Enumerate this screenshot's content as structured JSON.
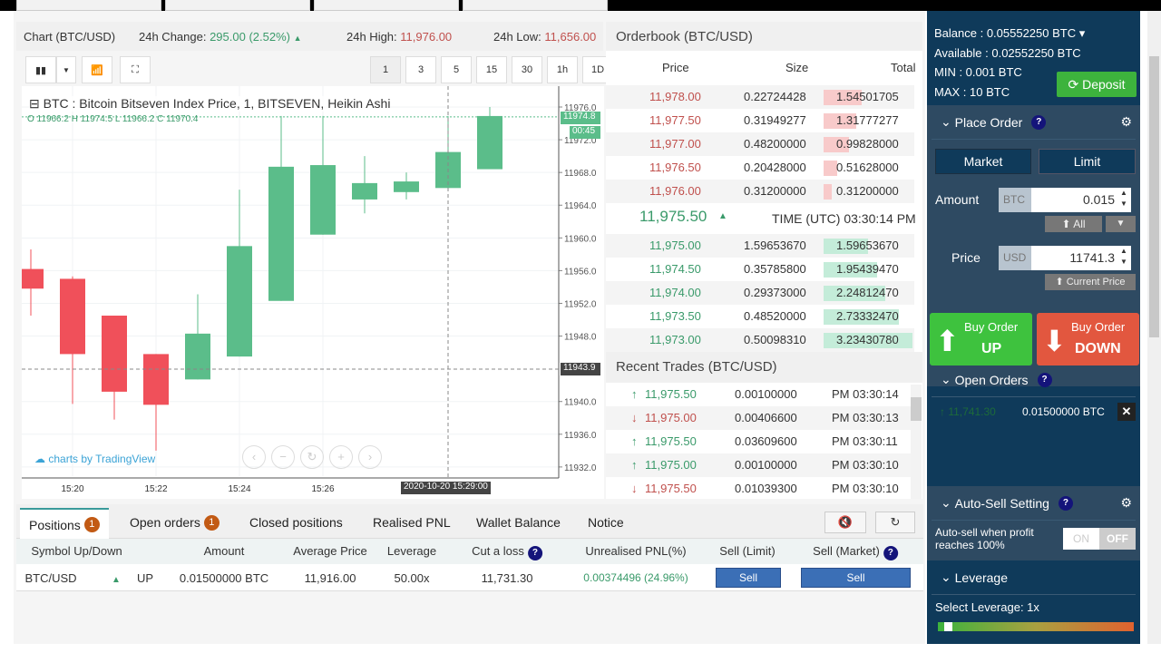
{
  "chart_header": {
    "title": "Chart (BTC/USD)",
    "change_label": "24h Change:",
    "change_value": "295.00 (2.52%)",
    "change_arrow": "▲",
    "high_label": "24h High:",
    "high_value": "11,976.00",
    "low_label": "24h Low:",
    "low_value": "11,656.00"
  },
  "toolbar": {
    "intervals": [
      "1",
      "3",
      "5",
      "15",
      "30",
      "1h",
      "1D"
    ],
    "active_interval": "1"
  },
  "chart": {
    "legend": "BTC : Bitcoin Bitseven Index Price, 1, BITSEVEN, Heikin Ashi",
    "ohlc": "O 11966.2  H 11974.5  L 11966.2  C 11970.4",
    "last_price_tag": "11974.8",
    "countdown": "00:45",
    "crosshair_price": "11943.9",
    "crosshair_time": "2020-10-20 15:29:00",
    "watermark": "charts by TradingView"
  },
  "chart_data": {
    "type": "candlestick",
    "x_ticks": [
      "15:20",
      "15:22",
      "15:24",
      "15:26"
    ],
    "y_ticks": [
      11976.0,
      11972.0,
      11968.0,
      11964.0,
      11960.0,
      11956.0,
      11952.0,
      11948.0,
      11940.0,
      11936.0,
      11932.0
    ],
    "ylim": [
      11930,
      11977
    ],
    "candles": [
      {
        "t": "15:19",
        "o": 11956.2,
        "h": 11958.6,
        "l": 11950.5,
        "c": 11953.8
      },
      {
        "t": "15:20",
        "o": 11955.0,
        "h": 11955.3,
        "l": 11939.7,
        "c": 11945.8
      },
      {
        "t": "15:21",
        "o": 11950.5,
        "h": 11950.5,
        "l": 11937.8,
        "c": 11941.2
      },
      {
        "t": "15:22",
        "o": 11945.8,
        "h": 11945.8,
        "l": 11934.0,
        "c": 11939.6
      },
      {
        "t": "15:23",
        "o": 11942.7,
        "h": 11953.1,
        "l": 11942.7,
        "c": 11948.3
      },
      {
        "t": "15:24",
        "o": 11945.5,
        "h": 11965.9,
        "l": 11945.5,
        "c": 11959.0
      },
      {
        "t": "15:25",
        "o": 11952.3,
        "h": 11974.9,
        "l": 11952.3,
        "c": 11968.7
      },
      {
        "t": "15:26",
        "o": 11960.4,
        "h": 11974.9,
        "l": 11960.4,
        "c": 11968.9
      },
      {
        "t": "15:27",
        "o": 11964.7,
        "h": 11970.0,
        "l": 11963.0,
        "c": 11966.7
      },
      {
        "t": "15:28",
        "o": 11965.6,
        "h": 11968.0,
        "l": 11964.7,
        "c": 11966.9
      },
      {
        "t": "15:29",
        "o": 11966.1,
        "h": 11974.9,
        "l": 11966.1,
        "c": 11970.5
      },
      {
        "t": "15:30",
        "o": 11968.4,
        "h": 11976.0,
        "l": 11968.4,
        "c": 11974.9
      }
    ],
    "colors": {
      "up": "#5bbd8a",
      "down": "#f0505a"
    }
  },
  "orderbook": {
    "title": "Orderbook (BTC/USD)",
    "headers": [
      "Price",
      "Size",
      "Total"
    ],
    "asks": [
      [
        "11,978.00",
        "0.22724428",
        "1.54501705",
        0.42
      ],
      [
        "11,977.50",
        "0.31949277",
        "1.31777277",
        0.36
      ],
      [
        "11,977.00",
        "0.48200000",
        "0.99828000",
        0.28
      ],
      [
        "11,976.50",
        "0.20428000",
        "0.51628000",
        0.15
      ],
      [
        "11,976.00",
        "0.31200000",
        "0.31200000",
        0.09
      ]
    ],
    "last_price": "11,975.50",
    "last_arrow": "▲",
    "time": "TIME (UTC) 03:30:14 PM",
    "bids": [
      [
        "11,975.00",
        "1.59653670",
        "1.59653670",
        0.49
      ],
      [
        "11,974.50",
        "0.35785800",
        "1.95439470",
        0.59
      ],
      [
        "11,974.00",
        "0.29373000",
        "2.24812470",
        0.68
      ],
      [
        "11,973.50",
        "0.48520000",
        "2.73332470",
        0.83
      ],
      [
        "11,973.00",
        "0.50098310",
        "3.23430780",
        0.98
      ]
    ]
  },
  "recent_trades": {
    "title": "Recent Trades (BTC/USD)",
    "rows": [
      [
        "up",
        "11,975.50",
        "0.00100000",
        "PM 03:30:14"
      ],
      [
        "down",
        "11,975.00",
        "0.00406600",
        "PM 03:30:13"
      ],
      [
        "up",
        "11,975.50",
        "0.03609600",
        "PM 03:30:11"
      ],
      [
        "up",
        "11,975.00",
        "0.00100000",
        "PM 03:30:10"
      ],
      [
        "down",
        "11,975.50",
        "0.01039300",
        "PM 03:30:10"
      ]
    ]
  },
  "account": {
    "balance": "Balance : 0.05552250 BTC",
    "available": "Available : 0.02552250 BTC",
    "min": "MIN : 0.001 BTC",
    "max": "MAX : 10 BTC",
    "deposit": "Deposit"
  },
  "place_order": {
    "title": "Place Order",
    "market": "Market",
    "limit": "Limit",
    "amount_label": "Amount",
    "amount_unit": "BTC",
    "amount_value": "0.015",
    "all": "⬆ All",
    "price_label": "Price",
    "price_unit": "USD",
    "price_value": "11741.3",
    "current_price": "⬆ Current Price",
    "buy_up_1": "Buy Order",
    "buy_up_2": "UP",
    "buy_down_1": "Buy Order",
    "buy_down_2": "DOWN"
  },
  "open_orders": {
    "title": "Open Orders",
    "price": "11,741.30",
    "amount": "0.01500000 BTC"
  },
  "auto_sell": {
    "title": "Auto-Sell Setting",
    "text": "Auto-sell when profit reaches 100%",
    "on": "ON",
    "off": "OFF"
  },
  "leverage": {
    "title": "Leverage",
    "select": "Select Leverage: 1x",
    "level_fraction": 0.0
  },
  "bottom": {
    "tabs": [
      {
        "label": "Positions",
        "badge": "1"
      },
      {
        "label": "Open orders",
        "badge": "1"
      },
      {
        "label": "Closed positions"
      },
      {
        "label": "Realised PNL"
      },
      {
        "label": "Wallet Balance"
      },
      {
        "label": "Notice"
      }
    ],
    "headers": [
      "Symbol",
      "Up/Down",
      "Amount",
      "Average Price",
      "Leverage",
      "Cut a loss",
      "Unrealised PNL(%)",
      "Sell (Limit)",
      "Sell (Market)"
    ],
    "row": {
      "symbol": "BTC/USD",
      "dir": "UP",
      "amount": "0.01500000 BTC",
      "avg": "11,916.00",
      "lev": "50.00x",
      "cut": "11,731.30",
      "pnl": "0.00374496 (24.96%)",
      "sell": "Sell",
      "sell2": "Sell"
    }
  }
}
